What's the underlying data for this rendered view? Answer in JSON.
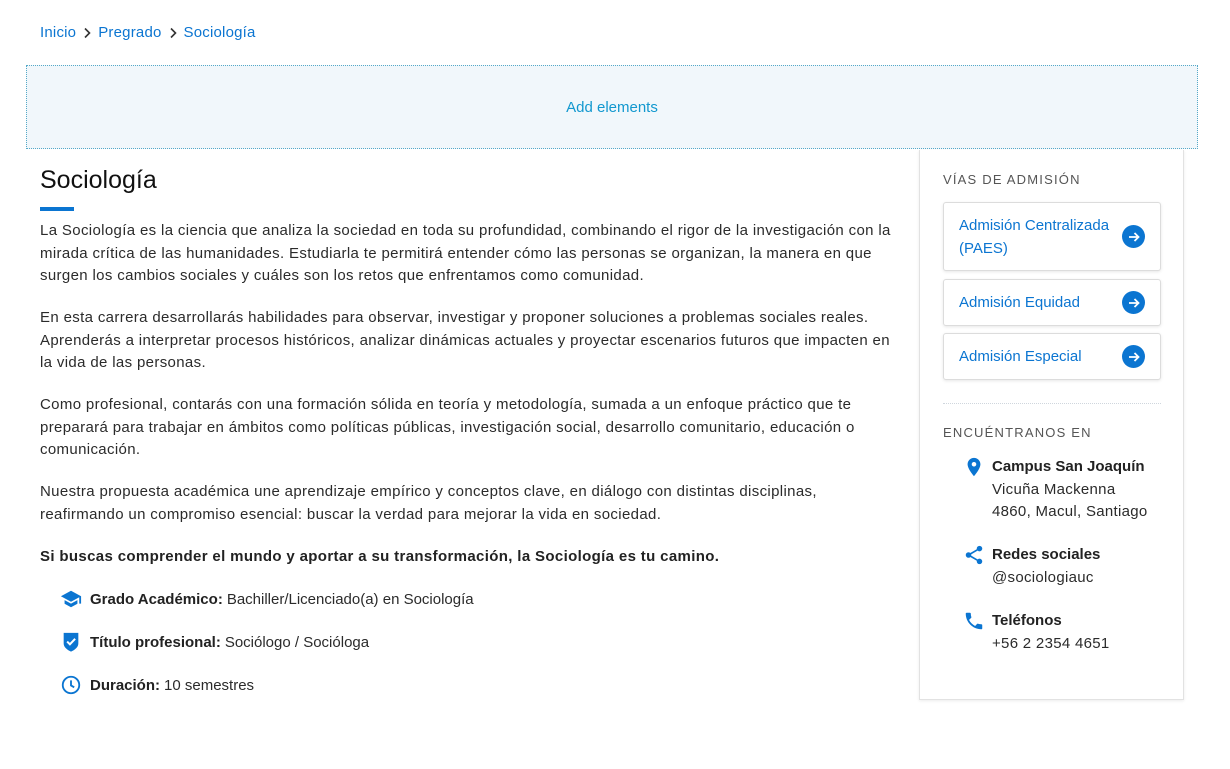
{
  "breadcrumb": {
    "home": "Inicio",
    "level2": "Pregrado",
    "current": "Sociología"
  },
  "builder": {
    "add_elements": "Add elements"
  },
  "main": {
    "title": "Sociología",
    "paragraphs": [
      "La Sociología es la ciencia que analiza la sociedad en toda su profundidad, combinando el rigor de la investigación con la mirada crítica de las humanidades. Estudiarla te permitirá entender cómo las personas se organizan, la manera en que surgen los cambios sociales y cuáles son los retos que enfrentamos como comunidad.",
      "En esta carrera desarrollarás habilidades para observar, investigar y proponer soluciones a problemas sociales reales. Aprenderás a interpretar procesos históricos, analizar dinámicas actuales y proyectar escenarios futuros que impacten en la vida de las personas.",
      "Como profesional, contarás con una formación sólida en teoría y metodología, sumada a un enfoque práctico que te preparará para trabajar en ámbitos como políticas públicas, investigación social, desarrollo comunitario, educación o comunicación.",
      "Nuestra propuesta académica une aprendizaje empírico y conceptos clave, en diálogo con distintas disciplinas, reafirmando un compromiso esencial: buscar la verdad para mejorar la vida en sociedad."
    ],
    "closing": "Si buscas comprender el mundo y aportar a su transformación, la Sociología es tu camino.",
    "facts": [
      {
        "icon": "graduation-cap-icon",
        "label": "Grado Académico:",
        "value": "Bachiller/Licenciado(a) en Sociología"
      },
      {
        "icon": "verified-badge-icon",
        "label": "Título profesional:",
        "value": "Sociólogo / Socióloga"
      },
      {
        "icon": "clock-icon",
        "label": "Duración:",
        "value": "10 semestres"
      }
    ]
  },
  "sidebar": {
    "admission_heading": "VÍAS DE ADMISIÓN",
    "admission_links": [
      {
        "label": "Admisión Centralizada (PAES)"
      },
      {
        "label": "Admisión Equidad"
      },
      {
        "label": "Admisión Especial"
      }
    ],
    "location_heading": "ENCUÉNTRANOS EN",
    "contacts": [
      {
        "icon": "location-pin-icon",
        "title": "Campus San Joaquín",
        "lines": [
          "Vicuña Mackenna",
          "4860, Macul, Santiago"
        ]
      },
      {
        "icon": "share-icon",
        "title": "Redes sociales",
        "lines": [
          "@sociologiauc"
        ]
      },
      {
        "icon": "phone-icon",
        "title": "Teléfonos",
        "lines": [
          "+56 2 2354 4651"
        ]
      }
    ]
  },
  "colors": {
    "accent": "#0b75d1",
    "builder_text": "#1298cf"
  }
}
